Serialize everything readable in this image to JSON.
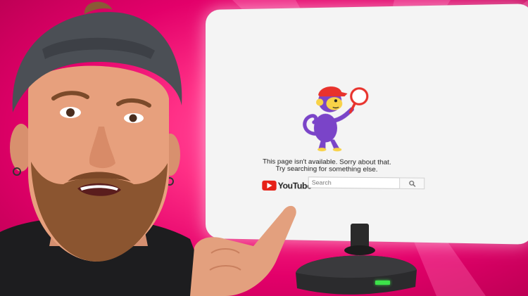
{
  "error_page": {
    "message_line_1": "This page isn't available. Sorry about that.",
    "message_line_2": "Try searching for something else.",
    "logo_text": "YouTube",
    "search": {
      "placeholder": "Search",
      "value": ""
    }
  },
  "colors": {
    "background": "#ff2f86",
    "screen": "#f4f4f4",
    "logo_red": "#e62117",
    "monkey_purple": "#7a44c8",
    "monkey_yellow": "#f8d248",
    "status_light": "#3de24a"
  },
  "icons": [
    "search-icon",
    "monkey-illustration",
    "youtube-logo"
  ]
}
